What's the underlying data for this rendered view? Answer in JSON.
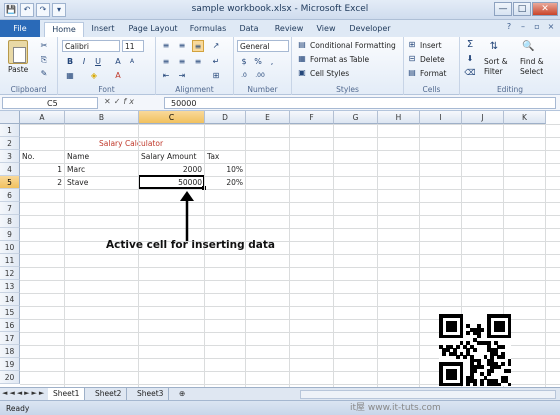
{
  "window": {
    "title": "sample workbook.xlsx - Microsoft Excel",
    "controls": [
      "—",
      "□",
      "✕"
    ]
  },
  "qat": [
    "💾",
    "↶",
    "↷",
    "▾"
  ],
  "tabs": [
    "File",
    "Home",
    "Insert",
    "Page Layout",
    "Formulas",
    "Data",
    "Review",
    "View",
    "Developer"
  ],
  "ribbon": {
    "clipboard": {
      "label": "Clipboard",
      "paste": "Paste"
    },
    "font": {
      "label": "Font",
      "font_name": "Calibri",
      "font_size": "11",
      "bold": "B",
      "italic": "I",
      "underline": "U"
    },
    "alignment": {
      "label": "Alignment"
    },
    "number": {
      "label": "Number",
      "format": "General",
      "currency": "$",
      "percent": "%",
      "comma": ","
    },
    "styles": {
      "label": "Styles",
      "conditional": "Conditional Formatting",
      "table": "Format as Table",
      "cell_styles": "Cell Styles"
    },
    "cells": {
      "label": "Cells",
      "insert": "Insert",
      "delete": "Delete",
      "format": "Format"
    },
    "editing": {
      "label": "Editing",
      "sum": "Σ",
      "sort": "Sort &",
      "filter": "Filter",
      "find": "Find &",
      "select": "Select"
    }
  },
  "formula_bar": {
    "name_box": "C5",
    "fx": "fx",
    "value": "50000"
  },
  "columns": [
    "A",
    "B",
    "C",
    "D",
    "E",
    "F",
    "G",
    "H",
    "I",
    "J",
    "K"
  ],
  "rows": [
    "1",
    "2",
    "3",
    "4",
    "5",
    "6",
    "7",
    "8",
    "9",
    "10",
    "11",
    "12",
    "13",
    "14",
    "15",
    "16",
    "17",
    "18",
    "19",
    "20"
  ],
  "sheet": {
    "title": "Salary Calculator",
    "headers": {
      "no": "No.",
      "name": "Name",
      "salary": "Salary Amount",
      "tax": "Tax"
    },
    "records": [
      {
        "no": "1",
        "name": "Marc",
        "salary": "2000",
        "tax": "10%"
      },
      {
        "no": "2",
        "name": "Stave",
        "salary": "50000",
        "tax": "20%"
      }
    ],
    "active_cell": "C5"
  },
  "annotation": "Active cell for inserting data",
  "sheet_tabs": [
    "Sheet1",
    "Sheet2",
    "Sheet3"
  ],
  "status": {
    "mode": "Ready"
  },
  "watermark": "it屋 www.it-tuts.com",
  "colors": {
    "title_red": "#c0392b",
    "file_tab": "#2a6ab8",
    "selection_header": "#f1c15f"
  }
}
